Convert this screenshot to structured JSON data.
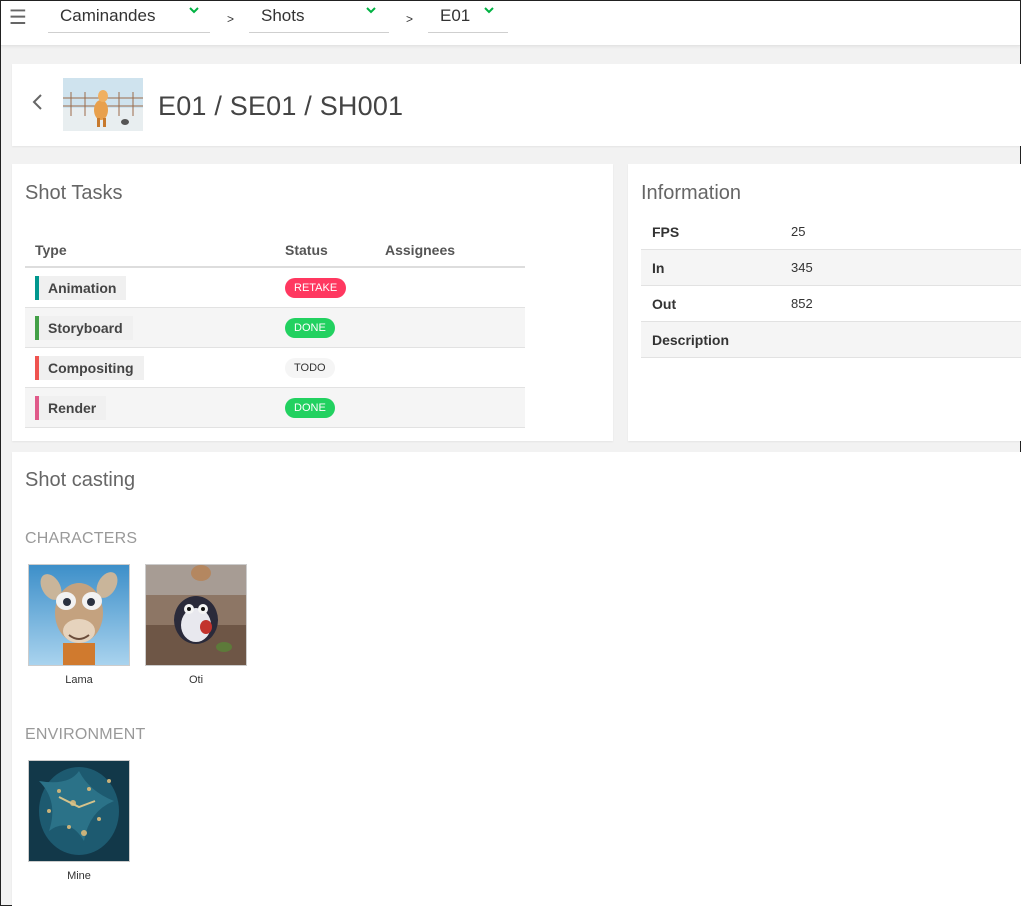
{
  "topbar": {
    "menu_icon": "hamburger-menu-icon",
    "production": "Caminandes",
    "section": "Shots",
    "episode": "E01",
    "separator": ">",
    "accent_color": "#00b242"
  },
  "header": {
    "title": "E01 / SE01 / SH001",
    "back_icon": "chevron-left-icon"
  },
  "tasks": {
    "title": "Shot Tasks",
    "columns": {
      "type": "Type",
      "status": "Status",
      "assignees": "Assignees"
    },
    "rows": [
      {
        "type": "Animation",
        "type_color": "#00978e",
        "status": "RETAKE",
        "status_color": "#ff3860",
        "status_text_color": "#ffffff",
        "assignees": ""
      },
      {
        "type": "Storyboard",
        "type_color": "#43a047",
        "status": "DONE",
        "status_color": "#22d160",
        "status_text_color": "#ffffff",
        "assignees": ""
      },
      {
        "type": "Compositing",
        "type_color": "#ef5350",
        "status": "TODO",
        "status_color": "#f5f5f5",
        "status_text_color": "#333333",
        "assignees": ""
      },
      {
        "type": "Render",
        "type_color": "#e05a8a",
        "status": "DONE",
        "status_color": "#22d160",
        "status_text_color": "#ffffff",
        "assignees": ""
      }
    ]
  },
  "information": {
    "title": "Information",
    "rows": [
      {
        "key": "FPS",
        "value": "25"
      },
      {
        "key": "In",
        "value": "345"
      },
      {
        "key": "Out",
        "value": "852"
      },
      {
        "key": "Description",
        "value": ""
      }
    ]
  },
  "casting": {
    "title": "Shot casting",
    "characters_label": "CHARACTERS",
    "characters": [
      {
        "name": "Lama"
      },
      {
        "name": "Oti"
      }
    ],
    "environment_label": "ENVIRONMENT",
    "environments": [
      {
        "name": "Mine"
      }
    ]
  }
}
